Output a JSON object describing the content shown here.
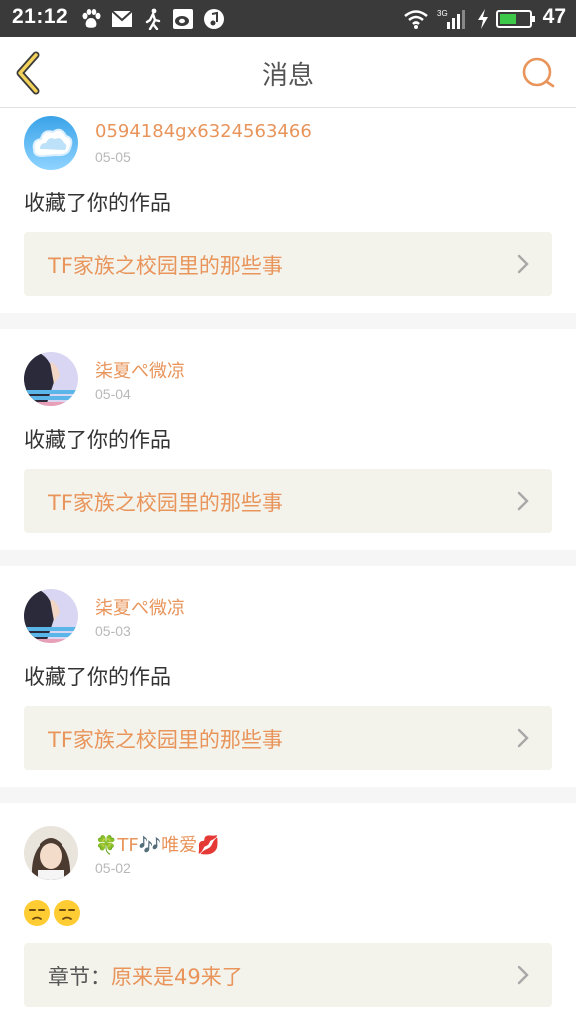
{
  "status_bar": {
    "time": "21:12",
    "battery_level": "47",
    "icons": [
      "baidu-paw-icon",
      "mail-icon",
      "walking-icon",
      "weibo-icon",
      "music-icon",
      "wifi-icon",
      "3g-signal-icon",
      "charging-icon",
      "battery-icon"
    ]
  },
  "header": {
    "title": "消息",
    "back_icon": "chevron-left-icon",
    "search_icon": "search-icon"
  },
  "colors": {
    "accent": "#e8945a",
    "back_arrow": "#f2d25a",
    "card_box": "#f3f3ec",
    "separator": "#f6f6f6"
  },
  "messages": [
    {
      "user": "0594184gx6324563466",
      "date": "05-05",
      "action": "收藏了你的作品",
      "work_prefix": "",
      "work_title": "TF家族之校园里的那些事"
    },
    {
      "user": "柒夏ぺ微凉",
      "date": "05-04",
      "action": "收藏了你的作品",
      "work_prefix": "",
      "work_title": "TF家族之校园里的那些事"
    },
    {
      "user": "柒夏ぺ微凉",
      "date": "05-03",
      "action": "收藏了你的作品",
      "work_prefix": "",
      "work_title": "TF家族之校园里的那些事"
    },
    {
      "user": "TF🎶唯爱",
      "date": "05-02",
      "action": "",
      "action_emoji": [
        "unamused-face",
        "unamused-face"
      ],
      "work_prefix": "章节：",
      "work_title": "原来是49来了"
    }
  ]
}
